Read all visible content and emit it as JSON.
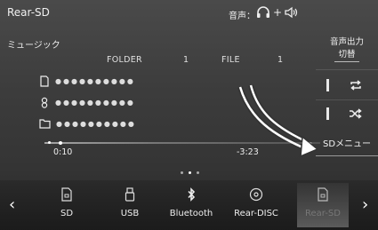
{
  "header": {
    "title": "Rear-SD",
    "audio_label": "音声："
  },
  "content": {
    "section_title": "ミュージック",
    "folder_label": "FOLDER",
    "folder_number": "1",
    "file_label": "FILE",
    "file_number": "1",
    "tracks": [
      {
        "icon": "music-note-icon",
        "text": "●●●●●●●●●●"
      },
      {
        "icon": "artist-icon",
        "text": "●●●●●●●●●●"
      },
      {
        "icon": "folder-icon",
        "text": "●●●●●●●●●●"
      }
    ],
    "audio_output": {
      "line1": "音声出力",
      "line2": "切替"
    },
    "sd_menu_label": "SDメニュー"
  },
  "playback": {
    "elapsed": "0:10",
    "remaining": "-3:23",
    "progress_fraction": 0.05
  },
  "sources": [
    {
      "label": "SD",
      "icon": "sd-card-icon"
    },
    {
      "label": "USB",
      "icon": "usb-icon"
    },
    {
      "label": "Bluetooth",
      "icon": "bluetooth-icon"
    },
    {
      "label": "Rear-DISC",
      "icon": "disc-icon"
    },
    {
      "label": "Rear-SD",
      "icon": "sd-card-icon",
      "active": true
    }
  ],
  "nav": {
    "prev": "‹",
    "next": "›"
  }
}
